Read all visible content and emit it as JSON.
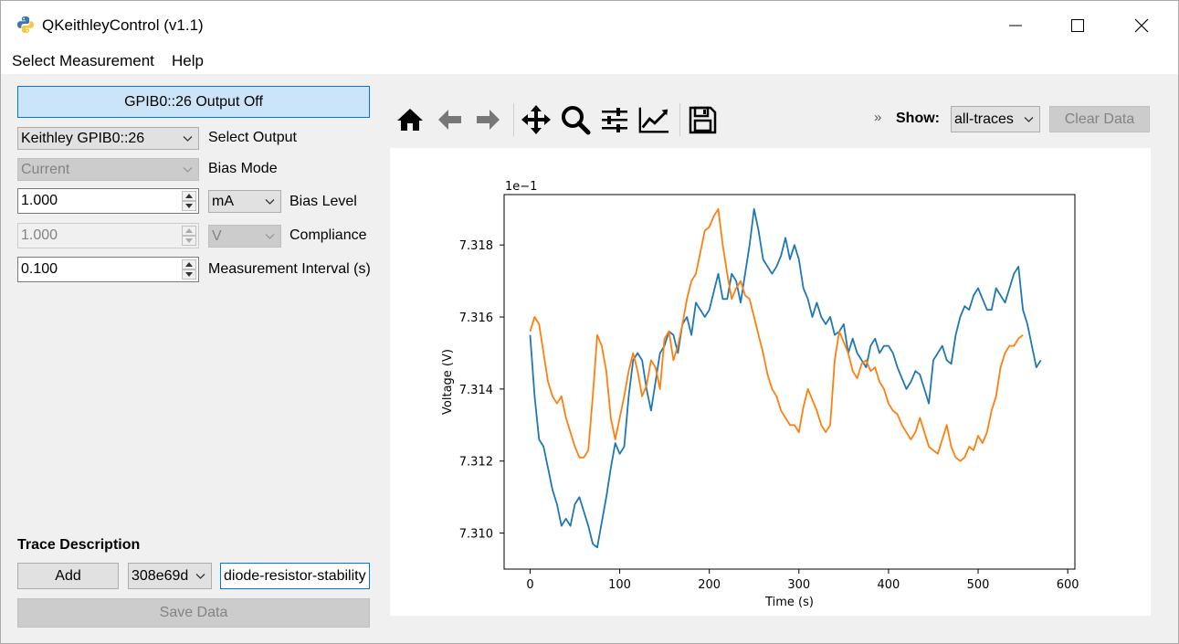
{
  "window": {
    "title": "QKeithleyControl (v1.1)"
  },
  "menu": {
    "items": [
      "Select Measurement",
      "Help"
    ]
  },
  "controls": {
    "output_button": "GPIB0::26 Output Off",
    "device_select": "Keithley GPIB0::26",
    "device_label": "Select Output",
    "bias_mode": "Current",
    "bias_mode_label": "Bias Mode",
    "bias_level": "1.000",
    "bias_unit": "mA",
    "bias_level_label": "Bias Level",
    "compliance": "1.000",
    "compliance_unit": "V",
    "compliance_label": "Compliance",
    "interval": "0.100",
    "interval_label": "Measurement Interval (s)"
  },
  "trace": {
    "heading": "Trace Description",
    "add_label": "Add",
    "trace_id": "308e69d",
    "description": "diode-resistor-stability",
    "save_label": "Save Data"
  },
  "toolbar": {
    "icons": [
      "home-icon",
      "back-icon",
      "forward-icon",
      "pan-icon",
      "zoom-icon",
      "configure-icon",
      "edit-axis-icon",
      "save-icon"
    ],
    "overflow": "»",
    "show_label": "Show:",
    "show_value": "all-traces",
    "clear_label": "Clear Data"
  },
  "chart_data": {
    "type": "line",
    "xlabel": "Time (s)",
    "ylabel": "Voltage (V)",
    "offset_text": "1e−1",
    "xlim": [
      -29,
      608
    ],
    "ylim": [
      7.309,
      7.3194
    ],
    "xticks": [
      "0",
      "100",
      "200",
      "300",
      "400",
      "500",
      "600"
    ],
    "yticks": [
      "7.310",
      "7.312",
      "7.314",
      "7.316",
      "7.318"
    ],
    "grid": false,
    "colors": {
      "blue": "#1f77b4",
      "orange": "#ff7f0e"
    },
    "series": [
      {
        "color": "#1f77b4",
        "x": [
          0,
          5,
          10,
          15,
          20,
          25,
          30,
          35,
          40,
          45,
          50,
          55,
          60,
          65,
          70,
          75,
          80,
          85,
          90,
          95,
          100,
          105,
          110,
          115,
          120,
          125,
          130,
          135,
          140,
          145,
          150,
          155,
          160,
          165,
          170,
          175,
          180,
          185,
          190,
          195,
          200,
          205,
          210,
          215,
          220,
          225,
          230,
          235,
          240,
          245,
          250,
          255,
          260,
          265,
          270,
          275,
          280,
          285,
          290,
          295,
          300,
          305,
          310,
          315,
          320,
          325,
          330,
          335,
          340,
          345,
          350,
          355,
          360,
          365,
          370,
          375,
          380,
          385,
          390,
          395,
          400,
          405,
          410,
          415,
          420,
          425,
          430,
          435,
          440,
          445,
          450,
          455,
          460,
          465,
          470,
          475,
          480,
          485,
          490,
          495,
          500,
          505,
          510,
          515,
          520,
          525,
          530,
          535,
          540,
          545,
          550,
          555,
          560,
          565,
          570
        ],
        "y": [
          7.3155,
          7.3138,
          7.3126,
          7.3124,
          7.3118,
          7.3112,
          7.3108,
          7.3102,
          7.3104,
          7.3102,
          7.3108,
          7.311,
          7.3106,
          7.3102,
          7.3097,
          7.3096,
          7.3103,
          7.311,
          7.3118,
          7.3125,
          7.3122,
          7.3124,
          7.3138,
          7.3148,
          7.315,
          7.3148,
          7.314,
          7.3134,
          7.3142,
          7.315,
          7.3152,
          7.3156,
          7.3155,
          7.315,
          7.3158,
          7.316,
          7.3155,
          7.3164,
          7.3162,
          7.316,
          7.3162,
          7.3167,
          7.3172,
          7.3165,
          7.3165,
          7.3172,
          7.317,
          7.3164,
          7.3172,
          7.318,
          7.319,
          7.3184,
          7.3176,
          7.3174,
          7.3172,
          7.3174,
          7.3177,
          7.3182,
          7.3176,
          7.318,
          7.3176,
          7.3168,
          7.3165,
          7.316,
          7.3164,
          7.316,
          7.3158,
          7.316,
          7.3155,
          7.3156,
          7.3158,
          7.315,
          7.3154,
          7.315,
          7.3148,
          7.3146,
          7.3152,
          7.3154,
          7.315,
          7.3152,
          7.3152,
          7.315,
          7.3146,
          7.3143,
          7.314,
          7.3142,
          7.3145,
          7.3144,
          7.314,
          7.3136,
          7.3148,
          7.315,
          7.3152,
          7.3148,
          7.3147,
          7.3155,
          7.316,
          7.3163,
          7.3162,
          7.3166,
          7.3168,
          7.3165,
          7.3162,
          7.3162,
          7.3168,
          7.3166,
          7.3164,
          7.3168,
          7.3172,
          7.3174,
          7.3162,
          7.3158,
          7.3152,
          7.3146,
          7.3148
        ]
      },
      {
        "color": "#ff7f0e",
        "x": [
          0,
          5,
          10,
          15,
          20,
          25,
          30,
          35,
          40,
          45,
          50,
          55,
          60,
          65,
          70,
          75,
          80,
          85,
          90,
          95,
          100,
          105,
          110,
          115,
          120,
          125,
          130,
          135,
          140,
          145,
          150,
          155,
          160,
          165,
          170,
          175,
          180,
          185,
          190,
          195,
          200,
          205,
          210,
          215,
          220,
          225,
          230,
          235,
          240,
          245,
          250,
          255,
          260,
          265,
          270,
          275,
          280,
          285,
          290,
          295,
          300,
          305,
          310,
          315,
          320,
          325,
          330,
          335,
          340,
          345,
          350,
          355,
          360,
          365,
          370,
          375,
          380,
          385,
          390,
          395,
          400,
          405,
          410,
          415,
          420,
          425,
          430,
          435,
          440,
          445,
          450,
          455,
          460,
          465,
          470,
          475,
          480,
          485,
          490,
          495,
          500,
          505,
          510,
          515,
          520,
          525,
          530,
          535,
          540,
          545,
          550
        ],
        "y": [
          7.3156,
          7.316,
          7.3158,
          7.315,
          7.3142,
          7.3138,
          7.3136,
          7.3138,
          7.3132,
          7.3128,
          7.3124,
          7.3121,
          7.3121,
          7.3123,
          7.3138,
          7.3155,
          7.3152,
          7.3145,
          7.3132,
          7.3126,
          7.3132,
          7.3138,
          7.3145,
          7.315,
          7.3145,
          7.3138,
          7.3141,
          7.3148,
          7.3146,
          7.314,
          7.3154,
          7.3156,
          7.3148,
          7.3152,
          7.3158,
          7.3165,
          7.317,
          7.3172,
          7.3178,
          7.3184,
          7.3185,
          7.3188,
          7.319,
          7.318,
          7.3172,
          7.3165,
          7.3168,
          7.317,
          7.3166,
          7.3165,
          7.316,
          7.3155,
          7.315,
          7.3144,
          7.314,
          7.3138,
          7.3134,
          7.3132,
          7.313,
          7.313,
          7.3128,
          7.3135,
          7.314,
          7.3137,
          7.3134,
          7.313,
          7.3128,
          7.313,
          7.3148,
          7.3156,
          7.3153,
          7.315,
          7.3145,
          7.3143,
          7.3147,
          7.3148,
          7.3145,
          7.3146,
          7.3142,
          7.314,
          7.3136,
          7.3134,
          7.3133,
          7.313,
          7.3128,
          7.3126,
          7.3128,
          7.3132,
          7.3128,
          7.3124,
          7.3123,
          7.3122,
          7.3126,
          7.313,
          7.3124,
          7.3121,
          7.312,
          7.3121,
          7.3124,
          7.3123,
          7.3127,
          7.3125,
          7.3128,
          7.3134,
          7.3138,
          7.3146,
          7.315,
          7.3152,
          7.3152,
          7.3154,
          7.3155
        ]
      }
    ]
  }
}
